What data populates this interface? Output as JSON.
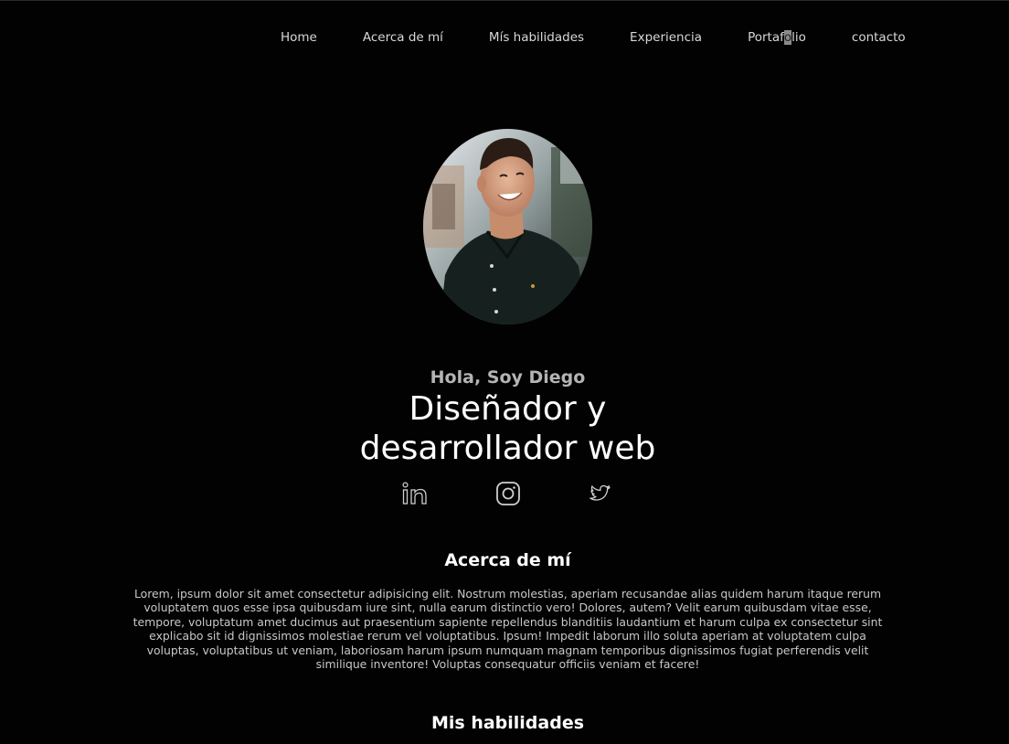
{
  "nav": {
    "items": [
      {
        "label": "Home"
      },
      {
        "label": "Acerca de mí"
      },
      {
        "label": "Mís habilidades"
      },
      {
        "label": "Experiencia"
      },
      {
        "label_pre": "Portaf",
        "label_sel": "o",
        "label_post": "lio"
      },
      {
        "label": "contacto"
      }
    ]
  },
  "hero": {
    "greeting": "Hola, Soy Diego",
    "title_line1": "Diseñador y",
    "title_line2": "desarrollador web"
  },
  "social": {
    "icons": [
      "linkedin-icon",
      "instagram-icon",
      "twitter-icon"
    ]
  },
  "about": {
    "title": "Acerca de mí",
    "text": "Lorem, ipsum dolor sit amet consectetur adipisicing elit. Nostrum molestias, aperiam recusandae alias quidem harum itaque rerum voluptatem quos esse ipsa quibusdam iure sint, nulla earum distinctio vero! Dolores, autem? Velit earum quibusdam vitae esse, tempore, voluptatum amet ducimus aut praesentium sapiente repellendus blanditiis laudantium et harum culpa ex consectetur sint explicabo sit id dignissimos molestiae rerum vel voluptatibus. Ipsum! Impedit laborum illo soluta aperiam at voluptatem culpa voluptas, voluptatibus ut veniam, laboriosam harum ipsum numquam magnam temporibus dignissimos fugiat perferendis velit similique inventore! Voluptas consequatur officiis veniam et facere!"
  },
  "skills": {
    "title": "Mis habilidades"
  },
  "colors": {
    "background": "#020203",
    "text": "#ffffff",
    "muted": "#b4b4b4"
  }
}
